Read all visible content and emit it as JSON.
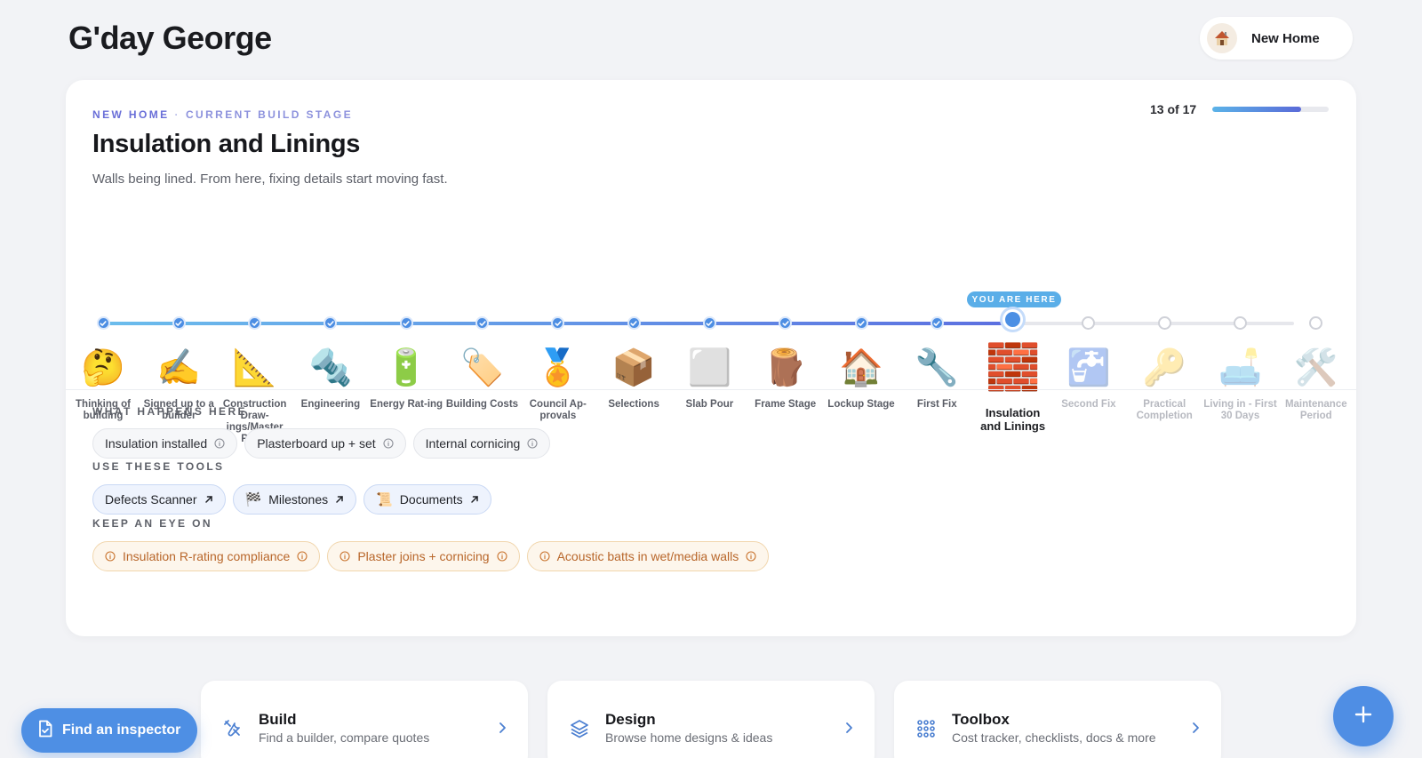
{
  "header": {
    "greeting": "G'day George",
    "home_switch_label": "New Home"
  },
  "stage_card": {
    "eyebrow_project": "NEW HOME",
    "eyebrow_section": "CURRENT BUILD STAGE",
    "title": "Insulation and Linings",
    "description": "Walls being lined. From here, fixing details start moving fast.",
    "progress_text": "13 of 17",
    "progress_fraction": 0.765,
    "you_are_here": "YOU ARE HERE"
  },
  "stages": [
    {
      "label": "Thinking of building",
      "status": "done",
      "emoji": "🤔"
    },
    {
      "label": "Signed up to a builder",
      "status": "done",
      "emoji": "✍️"
    },
    {
      "label": "Construction Draw-ings/Master Plans",
      "status": "done",
      "emoji": "📐"
    },
    {
      "label": "Engineering",
      "status": "done",
      "emoji": "🔩"
    },
    {
      "label": "Energy Rat-ing",
      "status": "done",
      "emoji": "🔋"
    },
    {
      "label": "Building Costs",
      "status": "done",
      "emoji": "🏷️"
    },
    {
      "label": "Council Ap-provals",
      "status": "done",
      "emoji": "🏅"
    },
    {
      "label": "Selections",
      "status": "done",
      "emoji": "📦"
    },
    {
      "label": "Slab Pour",
      "status": "done",
      "emoji": "⬜"
    },
    {
      "label": "Frame Stage",
      "status": "done",
      "emoji": "🪵"
    },
    {
      "label": "Lockup Stage",
      "status": "done",
      "emoji": "🏠"
    },
    {
      "label": "First Fix",
      "status": "done",
      "emoji": "🔧"
    },
    {
      "label": "Insulation and Linings",
      "status": "current",
      "emoji": "🧱"
    },
    {
      "label": "Second Fix",
      "status": "future",
      "emoji": "🚰"
    },
    {
      "label": "Practical Completion",
      "status": "future",
      "emoji": "🔑"
    },
    {
      "label": "Living in - First 30 Days",
      "status": "future",
      "emoji": "🛋️"
    },
    {
      "label": "Maintenance Period",
      "status": "future",
      "emoji": "🛠️"
    }
  ],
  "what_happens": {
    "title": "WHAT HAPPENS HERE",
    "items": [
      "Insulation installed",
      "Plasterboard up + set",
      "Internal cornicing"
    ]
  },
  "tools": {
    "title": "USE THESE TOOLS",
    "items": [
      {
        "label": "Defects Scanner",
        "icon": "none"
      },
      {
        "label": "Milestones",
        "icon": "🏁"
      },
      {
        "label": "Documents",
        "icon": "📜"
      }
    ]
  },
  "watch": {
    "title": "KEEP AN EYE ON",
    "items": [
      "Insulation R-rating compliance",
      "Plaster joins + cornicing",
      "Acoustic batts in wet/media walls"
    ]
  },
  "nav_cards": [
    {
      "title": "Build",
      "subtitle": "Find a builder, compare quotes",
      "icon": "tools-icon"
    },
    {
      "title": "Design",
      "subtitle": "Browse home designs & ideas",
      "icon": "layers-icon"
    },
    {
      "title": "Toolbox",
      "subtitle": "Cost tracker, checklists, docs & more",
      "icon": "grid-icon"
    }
  ],
  "inspector_button": "Find an inspector",
  "colors": {
    "accent": "#4e8fe4",
    "eyebrow": "#6a6fd8",
    "warn": "#b8662a"
  }
}
